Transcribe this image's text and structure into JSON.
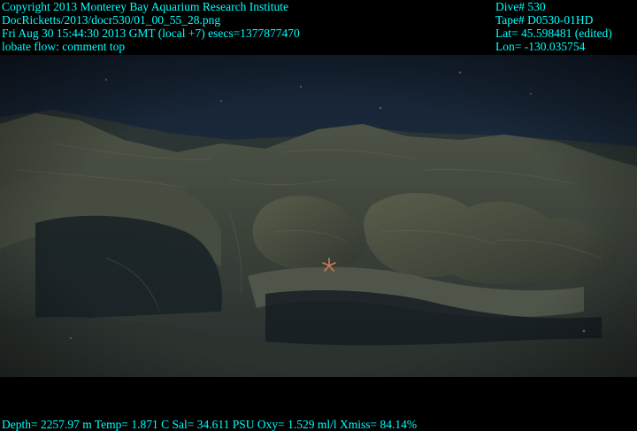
{
  "overlay": {
    "text_color": "#00ffff",
    "top_left": [
      "Copyright 2013 Monterey Bay Aquarium Research Institute",
      "DocRicketts/2013/docr530/01_00_55_28.png",
      "Fri Aug 30 15:44:30 2013 GMT (local +7)  esecs=1377877470",
      "lobate flow: comment top"
    ],
    "top_right": [
      "Dive# 530",
      "Tape# D0530-01HD",
      "Lat= 45.598481 (edited)",
      "Lon= -130.035754"
    ],
    "bottom": "Depth= 2257.97 m  Temp= 1.871 C  Sal= 34.611 PSU  Oxy= 1.529 ml/l  Xmiss= 84.14%"
  },
  "scene": {
    "water_color": "#1a2a3c",
    "rock_color": "#3a3f36",
    "rock_highlight": "#5a5e4c",
    "shadow_color": "#141a1e",
    "starfish_color": "#d07a5a"
  }
}
